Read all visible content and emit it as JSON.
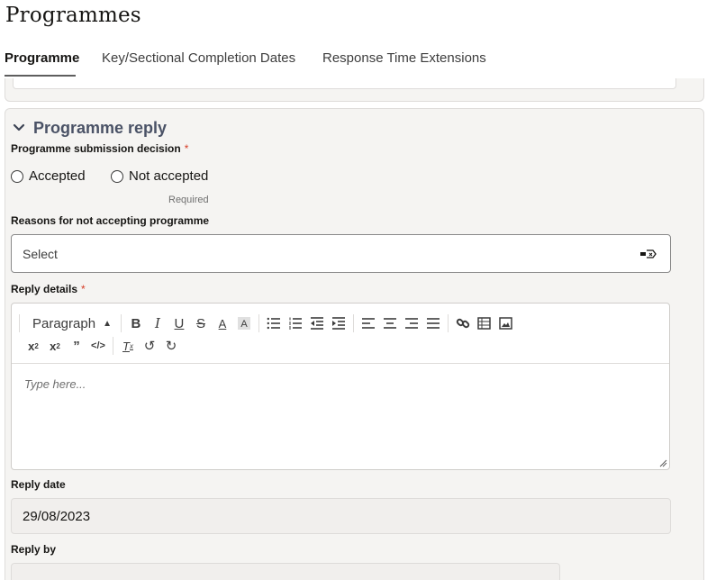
{
  "page": {
    "title": "Programmes"
  },
  "tabs": [
    {
      "label": "Programme",
      "active": true
    },
    {
      "label": "Key/Sectional Completion Dates",
      "active": false
    },
    {
      "label": "Response Time Extensions",
      "active": false
    }
  ],
  "section": {
    "title": "Programme reply",
    "icon": "chevron-down-icon"
  },
  "decision": {
    "label": "Programme submission decision",
    "required_mark": "*",
    "options": [
      "Accepted",
      "Not accepted"
    ],
    "selected": null,
    "helper": "Required"
  },
  "reasons": {
    "label": "Reasons for not accepting programme",
    "placeholder": "Select"
  },
  "reply_details": {
    "label": "Reply details",
    "required_mark": "*",
    "toolbar": {
      "block_format": "Paragraph",
      "buttons_row1": [
        "bold-icon",
        "italic-icon",
        "underline-icon",
        "strikethrough-icon",
        "font-color-icon",
        "highlight-icon",
        "bulleted-list-icon",
        "numbered-list-icon",
        "outdent-icon",
        "indent-icon",
        "align-left-icon",
        "align-center-icon",
        "align-right-icon",
        "justify-icon",
        "link-icon",
        "table-icon",
        "image-icon"
      ],
      "buttons_row2": [
        "subscript-icon",
        "superscript-icon",
        "blockquote-icon",
        "code-icon",
        "clear-format-icon",
        "undo-icon",
        "redo-icon"
      ]
    },
    "placeholder": "Type here..."
  },
  "reply_date": {
    "label": "Reply date",
    "value": "29/08/2023"
  },
  "reply_by": {
    "label": "Reply by",
    "value": ""
  },
  "colors": {
    "required": "#d63b25",
    "section_title": "#4a5266",
    "card_bg": "#f5f4f2"
  }
}
